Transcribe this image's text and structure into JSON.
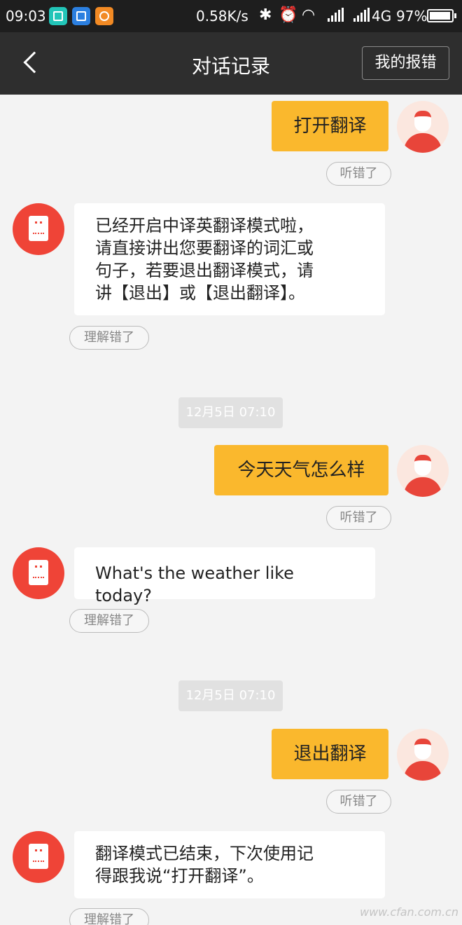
{
  "status_bar": {
    "time": "09:03",
    "net_speed": "0.58K/s",
    "network": "4G",
    "battery": "97%",
    "battery_level": 0.97,
    "icons": [
      "screenshot-app-icon",
      "message-app-icon",
      "headset-app-icon",
      "bluetooth-icon",
      "alarm-icon",
      "wifi-icon",
      "signal-icon",
      "battery-icon"
    ]
  },
  "header": {
    "title": "对话记录",
    "report_button": "我的报错"
  },
  "chat": {
    "msg1": {
      "text": "打开翻译",
      "action": "听错了"
    },
    "reply1": {
      "text": "已经开启中译英翻译模式啦，\n请直接讲出您要翻译的词汇或\n句子，若要退出翻译模式，请\n讲【退出】或【退出翻译】。",
      "action": "理解错了"
    },
    "time1": "12月5日 07:10",
    "msg2": {
      "text": "今天天气怎么样",
      "action": "听错了"
    },
    "reply2": {
      "text": "What's the weather like today?",
      "action": "理解错了"
    },
    "time2": "12月5日 07:10",
    "msg3": {
      "text": "退出翻译",
      "action": "听错了"
    },
    "reply3": {
      "text": "翻译模式已结束，下次使用记\n得跟我说“打开翻译”。",
      "action": "理解错了"
    }
  },
  "watermark": "www.cfan.com.cn",
  "colors": {
    "user_bubble": "#fab82d",
    "bot_avatar": "#ef4437",
    "header_bg": "#2e2e2e"
  }
}
